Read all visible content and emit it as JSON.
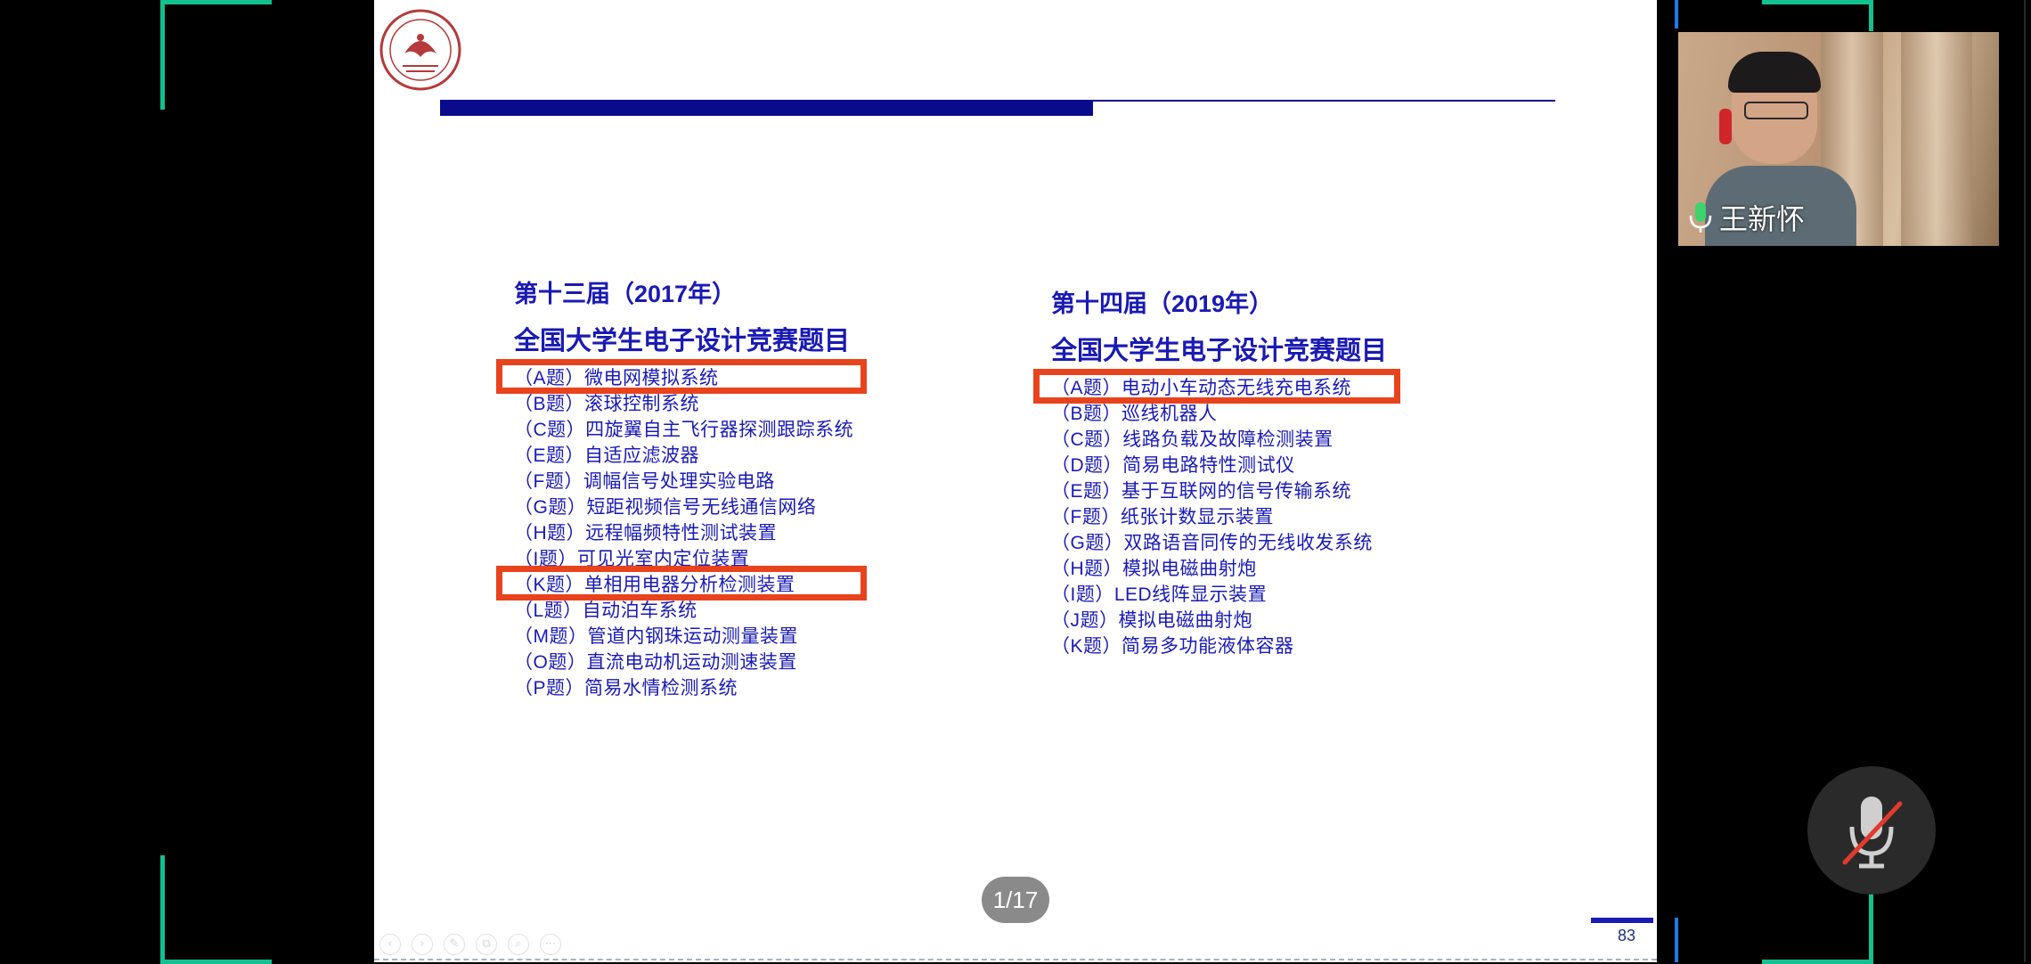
{
  "slide": {
    "logo_text": "XIDIAN UNIVERSITY",
    "left": {
      "edition": "第十三届（2017年）",
      "title": "全国大学生电子设计竞赛题目",
      "items": [
        "（A题）微电网模拟系统",
        "（B题）滚球控制系统",
        "（C题）四旋翼自主飞行器探测跟踪系统",
        "（E题）自适应滤波器",
        "（F题）调幅信号处理实验电路",
        "（G题）短距视频信号无线通信网络",
        "（H题）远程幅频特性测试装置",
        "（I题）可见光室内定位装置",
        "（K题）单相用电器分析检测装置",
        "（L题）自动泊车系统",
        "（M题）管道内钢珠运动测量装置",
        "（O题）直流电动机运动测速装置",
        "（P题）简易水情检测系统"
      ]
    },
    "right": {
      "edition": "第十四届（2019年）",
      "title": "全国大学生电子设计竞赛题目",
      "items": [
        "（A题）电动小车动态无线充电系统",
        "（B题）巡线机器人",
        "（C题）线路负载及故障检测装置",
        "（D题）简易电路特性测试仪",
        "（E题）基于互联网的信号传输系统",
        "（F题）纸张计数显示装置",
        "（G题）双路语音同传的无线收发系统",
        "（H题）模拟电磁曲射炮",
        "（I题）LED线阵显示装置",
        "（J题）模拟电磁曲射炮",
        "（K题）简易多功能液体容器"
      ]
    },
    "page_indicator": "1/17",
    "slide_number": "83"
  },
  "participant": {
    "name": "王新怀"
  },
  "icons": {
    "toolbar": [
      "prev-icon",
      "next-icon",
      "pen-icon",
      "copy-icon",
      "zoom-icon",
      "more-icon"
    ],
    "mic": "mic-muted-icon"
  },
  "colors": {
    "accent_green": "#12c18d",
    "highlight_red": "#e8431c",
    "text_blue": "#1a1ab4",
    "bar_navy": "#0a0a8c"
  }
}
